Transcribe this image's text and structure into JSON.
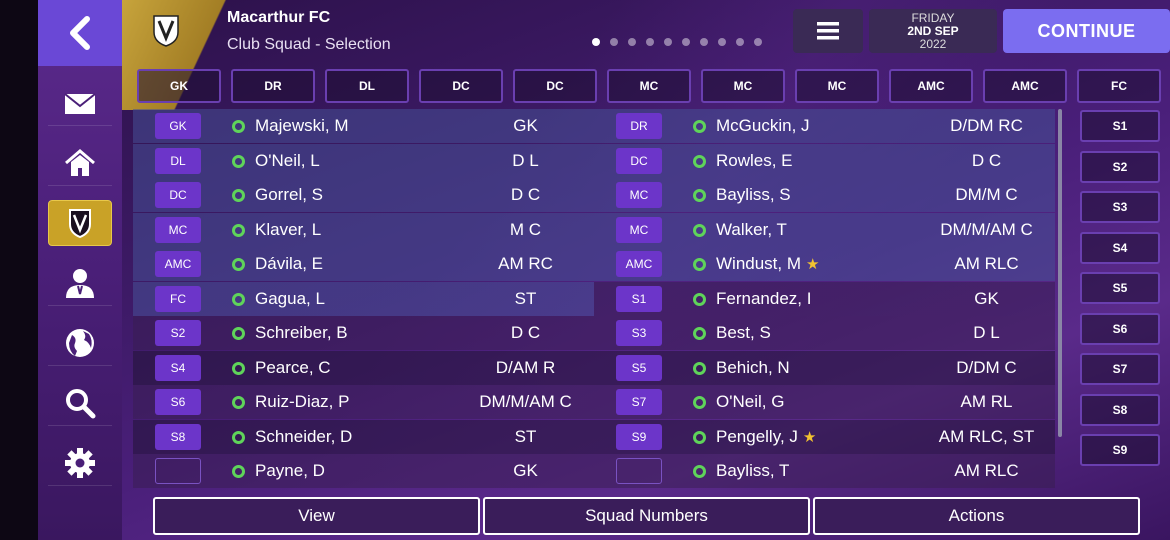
{
  "header": {
    "club_name": "Macarthur FC",
    "subtitle": "Club Squad - Selection",
    "page_dots": 10,
    "active_dot": 0,
    "date_day": "FRIDAY",
    "date_main": "2ND SEP",
    "date_year": "2022",
    "continue_label": "CONTINUE"
  },
  "sidebar": {
    "items": [
      {
        "icon": "back-arrow-icon"
      },
      {
        "icon": "mail-icon"
      },
      {
        "icon": "home-icon"
      },
      {
        "icon": "club-crest-icon",
        "active": true
      },
      {
        "icon": "person-icon"
      },
      {
        "icon": "globe-icon"
      },
      {
        "icon": "search-icon"
      },
      {
        "icon": "gear-icon"
      }
    ]
  },
  "positions": [
    "GK",
    "DR",
    "DL",
    "DC",
    "DC",
    "MC",
    "MC",
    "MC",
    "AMC",
    "AMC",
    "FC"
  ],
  "subs": [
    "S1",
    "S2",
    "S3",
    "S4",
    "S5",
    "S6",
    "S7",
    "S8",
    "S9"
  ],
  "left_rows": [
    {
      "badge": "GK",
      "name": "Majewski, M",
      "pos": "GK",
      "star": false
    },
    {
      "badge": "DL",
      "name": "O'Neil, L",
      "pos": "D L",
      "star": false
    },
    {
      "badge": "DC",
      "name": "Gorrel, S",
      "pos": "D C",
      "star": false
    },
    {
      "badge": "MC",
      "name": "Klaver, L",
      "pos": "M C",
      "star": false
    },
    {
      "badge": "AMC",
      "name": "Dávila, E",
      "pos": "AM RC",
      "star": false
    },
    {
      "badge": "FC",
      "name": "Gagua, L",
      "pos": "ST",
      "star": false
    },
    {
      "badge": "S2",
      "name": "Schreiber, B",
      "pos": "D C",
      "star": false
    },
    {
      "badge": "S4",
      "name": "Pearce, C",
      "pos": "D/AM R",
      "star": false
    },
    {
      "badge": "S6",
      "name": "Ruiz-Diaz, P",
      "pos": "DM/M/AM C",
      "star": false
    },
    {
      "badge": "S8",
      "name": "Schneider, D",
      "pos": "ST",
      "star": false
    },
    {
      "badge": "",
      "name": "Payne, D",
      "pos": "GK",
      "star": false
    }
  ],
  "right_rows": [
    {
      "badge": "DR",
      "name": "McGuckin, J",
      "pos": "D/DM RC",
      "star": false
    },
    {
      "badge": "DC",
      "name": "Rowles, E",
      "pos": "D C",
      "star": false
    },
    {
      "badge": "MC",
      "name": "Bayliss, S",
      "pos": "DM/M C",
      "star": false
    },
    {
      "badge": "MC",
      "name": "Walker, T",
      "pos": "DM/M/AM C",
      "star": false
    },
    {
      "badge": "AMC",
      "name": "Windust, M",
      "pos": "AM RLC",
      "star": true
    },
    {
      "badge": "S1",
      "name": "Fernandez, I",
      "pos": "GK",
      "star": false
    },
    {
      "badge": "S3",
      "name": "Best, S",
      "pos": "D L",
      "star": false
    },
    {
      "badge": "S5",
      "name": "Behich, N",
      "pos": "D/DM C",
      "star": false
    },
    {
      "badge": "S7",
      "name": "O'Neil, G",
      "pos": "AM RL",
      "star": false
    },
    {
      "badge": "S9",
      "name": "Pengelly, J",
      "pos": "AM RLC, ST",
      "star": true
    },
    {
      "badge": "",
      "name": "Bayliss, T",
      "pos": "AM RLC",
      "star": false
    }
  ],
  "bottom": {
    "view_label": "View",
    "squad_numbers_label": "Squad Numbers",
    "actions_label": "Actions"
  },
  "colors": {
    "accent": "#7b6df0",
    "badge": "#6c35c9",
    "status_ok": "#5fd45a",
    "star": "#f2c230",
    "active_nav": "#c9a227"
  }
}
